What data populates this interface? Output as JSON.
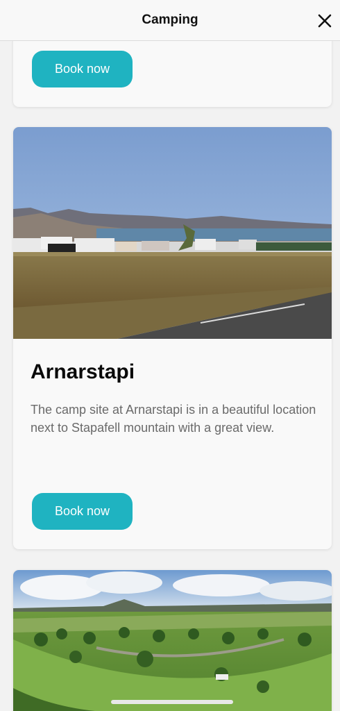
{
  "header": {
    "title": "Camping",
    "close_icon": "close-icon"
  },
  "cards": [
    {
      "book_label": "Book now"
    },
    {
      "title": "Arnarstapi",
      "description": "The camp site at Arnarstapi is in a beautiful location next to Stapafell mountain with a great view.",
      "book_label": "Book now"
    },
    {}
  ],
  "colors": {
    "accent": "#1fb3c1"
  }
}
